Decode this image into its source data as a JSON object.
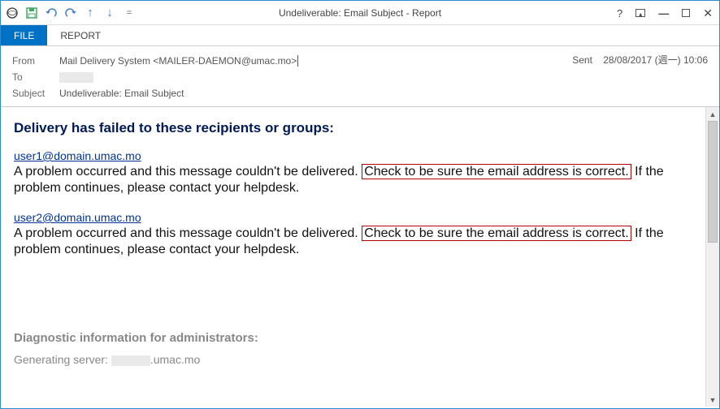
{
  "window": {
    "title": "Undeliverable: Email Subject - Report"
  },
  "qat": {
    "save": "save-icon",
    "undo": "undo-icon",
    "redo": "redo-icon",
    "up": "up-arrow-icon",
    "down": "down-arrow-icon",
    "customizer": "="
  },
  "tabs": {
    "file": "FILE",
    "report": "REPORT"
  },
  "headers": {
    "from_label": "From",
    "from_value": "Mail Delivery System <MAILER-DAEMON@umac.mo>",
    "to_label": "To",
    "subject_label": "Subject",
    "subject_value": "Undeliverable: Email Subject",
    "sent_label": "Sent",
    "sent_value": "28/08/2017 (週一) 10:06"
  },
  "body": {
    "fail_title": "Delivery has failed to these recipients or groups:",
    "recipients": [
      {
        "email": "user1@domain.umac.mo",
        "msg_pre": "A problem occurred and this message couldn't be delivered. ",
        "msg_box": "Check to be sure the email address is correct.",
        "msg_post": " If the problem continues, please contact your helpdesk."
      },
      {
        "email": "user2@domain.umac.mo",
        "msg_pre": "A problem occurred and this message couldn't be delivered. ",
        "msg_box": "Check to be sure the email address is correct.",
        "msg_post": " If the problem continues, please contact your helpdesk."
      }
    ],
    "diag_title": "Diagnostic information for administrators:",
    "gen_server_label": "Generating server: ",
    "gen_server_suffix": ".umac.mo"
  }
}
